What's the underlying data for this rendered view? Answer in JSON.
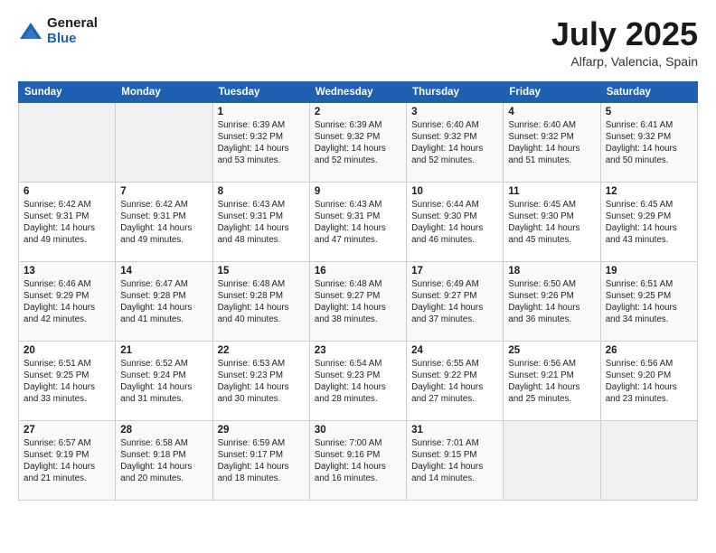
{
  "logo": {
    "general": "General",
    "blue": "Blue"
  },
  "header": {
    "month": "July 2025",
    "location": "Alfarp, Valencia, Spain"
  },
  "days_of_week": [
    "Sunday",
    "Monday",
    "Tuesday",
    "Wednesday",
    "Thursday",
    "Friday",
    "Saturday"
  ],
  "weeks": [
    [
      {
        "day": "",
        "info": ""
      },
      {
        "day": "",
        "info": ""
      },
      {
        "day": "1",
        "info": "Sunrise: 6:39 AM\nSunset: 9:32 PM\nDaylight: 14 hours and 53 minutes."
      },
      {
        "day": "2",
        "info": "Sunrise: 6:39 AM\nSunset: 9:32 PM\nDaylight: 14 hours and 52 minutes."
      },
      {
        "day": "3",
        "info": "Sunrise: 6:40 AM\nSunset: 9:32 PM\nDaylight: 14 hours and 52 minutes."
      },
      {
        "day": "4",
        "info": "Sunrise: 6:40 AM\nSunset: 9:32 PM\nDaylight: 14 hours and 51 minutes."
      },
      {
        "day": "5",
        "info": "Sunrise: 6:41 AM\nSunset: 9:32 PM\nDaylight: 14 hours and 50 minutes."
      }
    ],
    [
      {
        "day": "6",
        "info": "Sunrise: 6:42 AM\nSunset: 9:31 PM\nDaylight: 14 hours and 49 minutes."
      },
      {
        "day": "7",
        "info": "Sunrise: 6:42 AM\nSunset: 9:31 PM\nDaylight: 14 hours and 49 minutes."
      },
      {
        "day": "8",
        "info": "Sunrise: 6:43 AM\nSunset: 9:31 PM\nDaylight: 14 hours and 48 minutes."
      },
      {
        "day": "9",
        "info": "Sunrise: 6:43 AM\nSunset: 9:31 PM\nDaylight: 14 hours and 47 minutes."
      },
      {
        "day": "10",
        "info": "Sunrise: 6:44 AM\nSunset: 9:30 PM\nDaylight: 14 hours and 46 minutes."
      },
      {
        "day": "11",
        "info": "Sunrise: 6:45 AM\nSunset: 9:30 PM\nDaylight: 14 hours and 45 minutes."
      },
      {
        "day": "12",
        "info": "Sunrise: 6:45 AM\nSunset: 9:29 PM\nDaylight: 14 hours and 43 minutes."
      }
    ],
    [
      {
        "day": "13",
        "info": "Sunrise: 6:46 AM\nSunset: 9:29 PM\nDaylight: 14 hours and 42 minutes."
      },
      {
        "day": "14",
        "info": "Sunrise: 6:47 AM\nSunset: 9:28 PM\nDaylight: 14 hours and 41 minutes."
      },
      {
        "day": "15",
        "info": "Sunrise: 6:48 AM\nSunset: 9:28 PM\nDaylight: 14 hours and 40 minutes."
      },
      {
        "day": "16",
        "info": "Sunrise: 6:48 AM\nSunset: 9:27 PM\nDaylight: 14 hours and 38 minutes."
      },
      {
        "day": "17",
        "info": "Sunrise: 6:49 AM\nSunset: 9:27 PM\nDaylight: 14 hours and 37 minutes."
      },
      {
        "day": "18",
        "info": "Sunrise: 6:50 AM\nSunset: 9:26 PM\nDaylight: 14 hours and 36 minutes."
      },
      {
        "day": "19",
        "info": "Sunrise: 6:51 AM\nSunset: 9:25 PM\nDaylight: 14 hours and 34 minutes."
      }
    ],
    [
      {
        "day": "20",
        "info": "Sunrise: 6:51 AM\nSunset: 9:25 PM\nDaylight: 14 hours and 33 minutes."
      },
      {
        "day": "21",
        "info": "Sunrise: 6:52 AM\nSunset: 9:24 PM\nDaylight: 14 hours and 31 minutes."
      },
      {
        "day": "22",
        "info": "Sunrise: 6:53 AM\nSunset: 9:23 PM\nDaylight: 14 hours and 30 minutes."
      },
      {
        "day": "23",
        "info": "Sunrise: 6:54 AM\nSunset: 9:23 PM\nDaylight: 14 hours and 28 minutes."
      },
      {
        "day": "24",
        "info": "Sunrise: 6:55 AM\nSunset: 9:22 PM\nDaylight: 14 hours and 27 minutes."
      },
      {
        "day": "25",
        "info": "Sunrise: 6:56 AM\nSunset: 9:21 PM\nDaylight: 14 hours and 25 minutes."
      },
      {
        "day": "26",
        "info": "Sunrise: 6:56 AM\nSunset: 9:20 PM\nDaylight: 14 hours and 23 minutes."
      }
    ],
    [
      {
        "day": "27",
        "info": "Sunrise: 6:57 AM\nSunset: 9:19 PM\nDaylight: 14 hours and 21 minutes."
      },
      {
        "day": "28",
        "info": "Sunrise: 6:58 AM\nSunset: 9:18 PM\nDaylight: 14 hours and 20 minutes."
      },
      {
        "day": "29",
        "info": "Sunrise: 6:59 AM\nSunset: 9:17 PM\nDaylight: 14 hours and 18 minutes."
      },
      {
        "day": "30",
        "info": "Sunrise: 7:00 AM\nSunset: 9:16 PM\nDaylight: 14 hours and 16 minutes."
      },
      {
        "day": "31",
        "info": "Sunrise: 7:01 AM\nSunset: 9:15 PM\nDaylight: 14 hours and 14 minutes."
      },
      {
        "day": "",
        "info": ""
      },
      {
        "day": "",
        "info": ""
      }
    ]
  ]
}
